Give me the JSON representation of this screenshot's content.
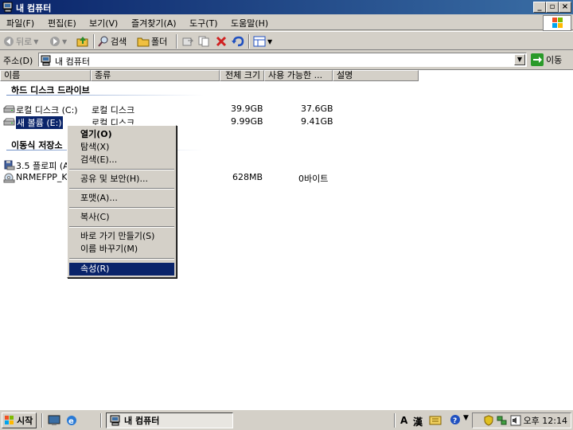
{
  "window": {
    "title": "내 컴퓨터"
  },
  "menu": [
    "파일(F)",
    "편집(E)",
    "보기(V)",
    "즐겨찾기(A)",
    "도구(T)",
    "도움말(H)"
  ],
  "toolbar": {
    "back": "뒤로",
    "search": "검색",
    "folders": "폴더"
  },
  "address": {
    "label": "주소(D)",
    "value": "내 컴퓨터",
    "go": "이동"
  },
  "columns": [
    "이름",
    "종류",
    "전체 크기",
    "사용 가능한 ...",
    "설명"
  ],
  "groups": {
    "hard_disks": "하드 디스크 드라이브",
    "removable": "이동식 저장소"
  },
  "drives": [
    {
      "name": "로컬 디스크 (C:)",
      "type": "로컬 디스크",
      "total": "39.9GB",
      "free": "37.6GB"
    },
    {
      "name": "새 볼륨 (E:)",
      "type": "로컬 디스크",
      "total": "9.99GB",
      "free": "9.41GB"
    }
  ],
  "removable_items": [
    {
      "name": "3.5 플로피 (A",
      "type": "",
      "total": "",
      "free": ""
    },
    {
      "name": "NRMEFPP_K",
      "type": "",
      "total": "628MB",
      "free": "0바이트"
    }
  ],
  "context_menu": {
    "open": "열기(O)",
    "explore": "탐색(X)",
    "search": "검색(E)...",
    "share": "공유 및 보안(H)...",
    "format": "포맷(A)...",
    "copy": "복사(C)",
    "shortcut": "바로 가기 만들기(S)",
    "rename": "이름 바꾸기(M)",
    "properties": "속성(R)"
  },
  "taskbar": {
    "start": "시작",
    "task": "내 컴퓨터",
    "clock": "오후 12:14",
    "ime_a": "A",
    "ime_han": "漢"
  },
  "colors": {
    "title": "#0a246a",
    "selection": "#0a246a",
    "face": "#d4d0c8"
  }
}
